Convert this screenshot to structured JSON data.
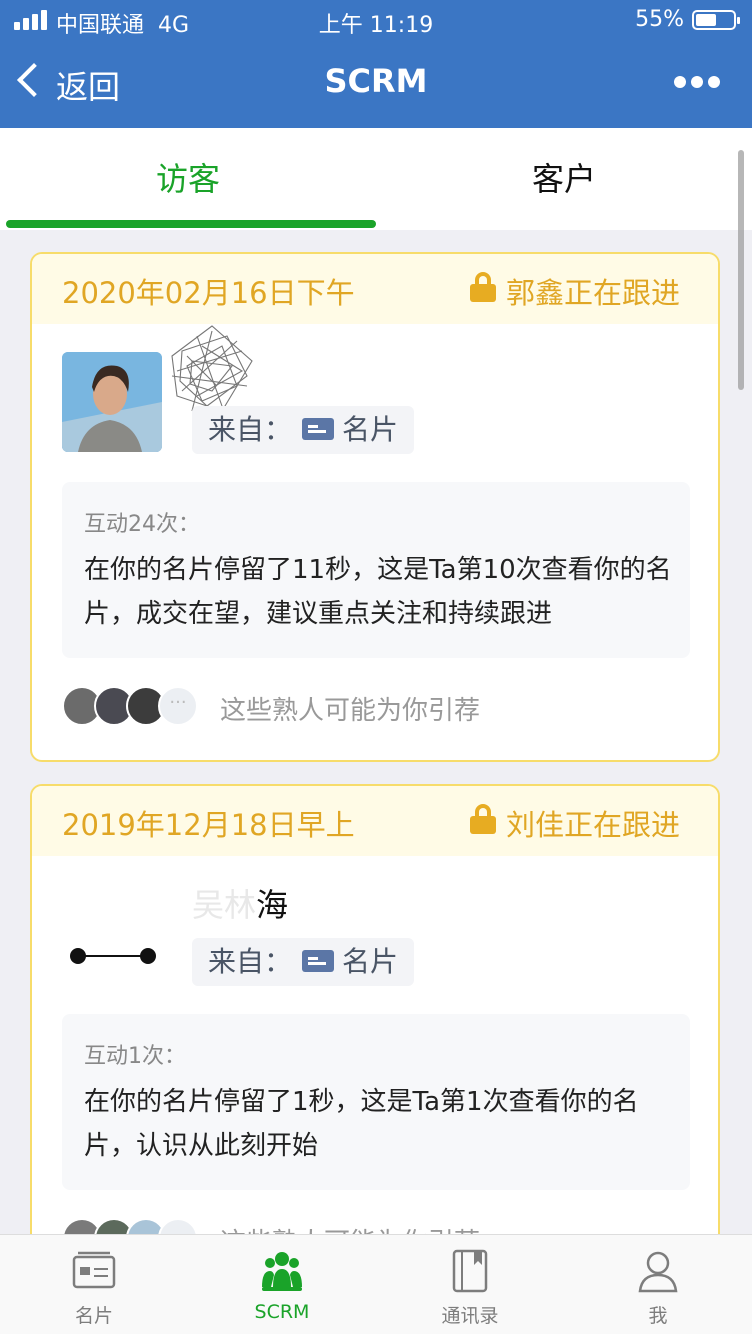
{
  "status_bar": {
    "carrier": "中国联通",
    "network": "4G",
    "time": "上午 11:19",
    "battery": "55%",
    "battery_level": 0.55
  },
  "nav": {
    "back_label": "返回",
    "title": "SCRM",
    "more_icon": "more-icon"
  },
  "tabs": [
    {
      "label": "访客",
      "active": true
    },
    {
      "label": "客户",
      "active": false
    }
  ],
  "visitors": [
    {
      "date": "2020年02月16日下午",
      "follower": "郭鑫正在跟进",
      "name_visible": "",
      "source_label": "来自：",
      "source_value": "名片",
      "interaction_count": "互动24次：",
      "interaction_text": "在你的名片停留了11秒，这是Ta第10次查看你的名片，成交在望，建议重点关注和持续跟进",
      "referral_text": "这些熟人可能为你引荐"
    },
    {
      "date": "2019年12月18日早上",
      "follower": "刘佳正在跟进",
      "name_visible": "海",
      "source_label": "来自：",
      "source_value": "名片",
      "interaction_count": "互动1次：",
      "interaction_text": "在你的名片停留了1秒，这是Ta第1次查看你的名片，认识从此刻开始",
      "referral_text": "这些熟人可能为你引荐"
    }
  ],
  "tabbar": [
    {
      "label": "名片",
      "icon": "business-card-icon",
      "active": false
    },
    {
      "label": "SCRM",
      "icon": "people-group-icon",
      "active": true
    },
    {
      "label": "通讯录",
      "icon": "address-book-icon",
      "active": false
    },
    {
      "label": "我",
      "icon": "person-icon",
      "active": false
    }
  ],
  "colors": {
    "nav_blue": "#3b76c4",
    "accent_green": "#1aa329",
    "gold": "#e0a624"
  }
}
